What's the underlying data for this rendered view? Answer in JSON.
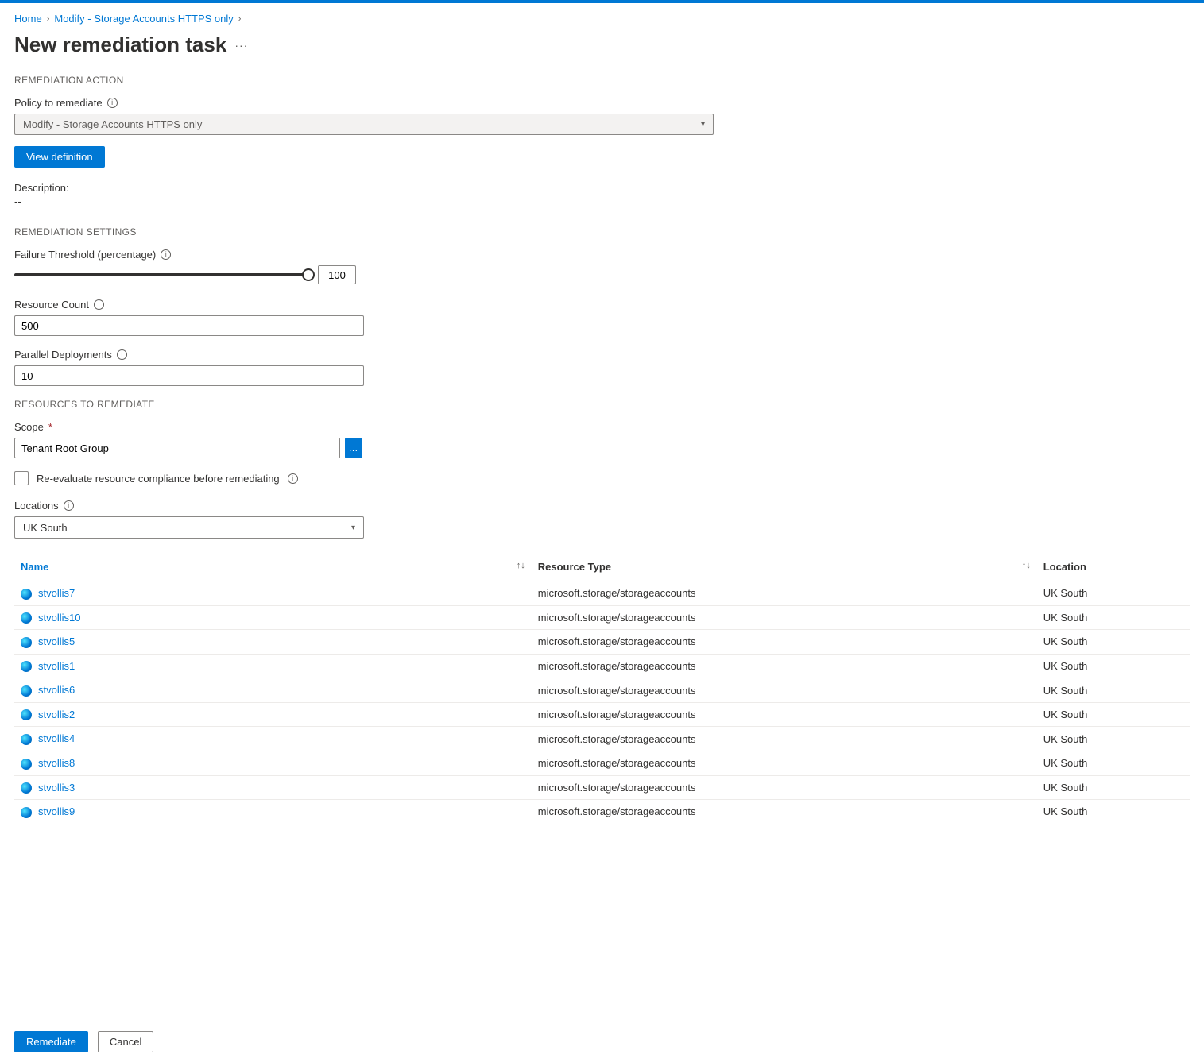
{
  "breadcrumb": {
    "home": "Home",
    "policy": "Modify - Storage Accounts HTTPS only"
  },
  "title": "New remediation task",
  "sections": {
    "action": "REMEDIATION ACTION",
    "settings": "REMEDIATION SETTINGS",
    "resources": "RESOURCES TO REMEDIATE"
  },
  "policy": {
    "label": "Policy to remediate",
    "value": "Modify - Storage Accounts HTTPS only",
    "view_def": "View definition",
    "desc_label": "Description:",
    "desc_value": "--"
  },
  "settings": {
    "failure_threshold_label": "Failure Threshold (percentage)",
    "failure_threshold_value": "100",
    "resource_count_label": "Resource Count",
    "resource_count_value": "500",
    "parallel_label": "Parallel Deployments",
    "parallel_value": "10"
  },
  "resources": {
    "scope_label": "Scope",
    "scope_value": "Tenant Root Group",
    "reeval_label": "Re-evaluate resource compliance before remediating",
    "locations_label": "Locations",
    "locations_value": "UK South"
  },
  "table": {
    "headers": {
      "name": "Name",
      "type": "Resource Type",
      "location": "Location"
    },
    "rows": [
      {
        "name": "stvollis7",
        "type": "microsoft.storage/storageaccounts",
        "location": "UK South"
      },
      {
        "name": "stvollis10",
        "type": "microsoft.storage/storageaccounts",
        "location": "UK South"
      },
      {
        "name": "stvollis5",
        "type": "microsoft.storage/storageaccounts",
        "location": "UK South"
      },
      {
        "name": "stvollis1",
        "type": "microsoft.storage/storageaccounts",
        "location": "UK South"
      },
      {
        "name": "stvollis6",
        "type": "microsoft.storage/storageaccounts",
        "location": "UK South"
      },
      {
        "name": "stvollis2",
        "type": "microsoft.storage/storageaccounts",
        "location": "UK South"
      },
      {
        "name": "stvollis4",
        "type": "microsoft.storage/storageaccounts",
        "location": "UK South"
      },
      {
        "name": "stvollis8",
        "type": "microsoft.storage/storageaccounts",
        "location": "UK South"
      },
      {
        "name": "stvollis3",
        "type": "microsoft.storage/storageaccounts",
        "location": "UK South"
      },
      {
        "name": "stvollis9",
        "type": "microsoft.storage/storageaccounts",
        "location": "UK South"
      }
    ]
  },
  "footer": {
    "remediate": "Remediate",
    "cancel": "Cancel"
  }
}
